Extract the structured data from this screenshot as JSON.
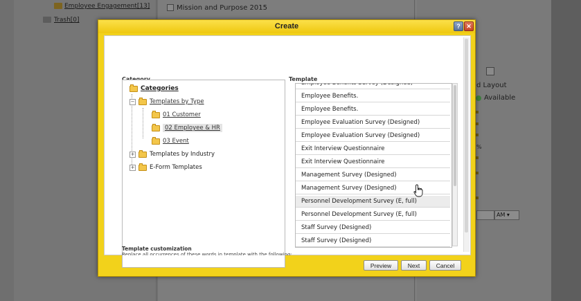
{
  "background": {
    "left_links": [
      "Employee Engagement[13]",
      "Trash[0]"
    ],
    "middle_item": "Mission and Purpose 2015",
    "right_texts": [
      "d Layout",
      "Available",
      "%"
    ],
    "selects": [
      "AM ▾"
    ]
  },
  "dialog": {
    "title": "Create",
    "help_icon": "?",
    "close_icon": "✕",
    "category_label": "Category",
    "template_label": "Template",
    "tree": {
      "root": "Categories",
      "templates_by_type": "Templates by Type",
      "customer": "01 Customer",
      "employee_hr": "02 Employee & HR",
      "event": "03 Event",
      "templates_by_industry": "Templates by Industry",
      "eform_templates": "E-Form Templates"
    },
    "templates": [
      "Employee Benefits Survey (Designed)",
      "Employee Benefits.",
      "Employee Benefits.",
      "Employee Evaluation Survey (Designed)",
      "Employee Evaluation Survey (Designed)",
      "Exit Interview Questionnaire",
      "Exit Interview Questionnaire",
      "Management Survey (Designed)",
      "Management Survey (Designed)",
      "Personnel Development Survey (E, full)",
      "Personnel Development Survey (E, full)",
      "Staff Survey (Designed)",
      "Staff Survey (Designed)"
    ],
    "customization_label": "Template customization",
    "customization_hint": "Replace all occurrences of these words in template with the following:",
    "buttons": {
      "preview": "Preview",
      "next": "Next",
      "cancel": "Cancel"
    },
    "accent_color": "#f2d21b"
  }
}
